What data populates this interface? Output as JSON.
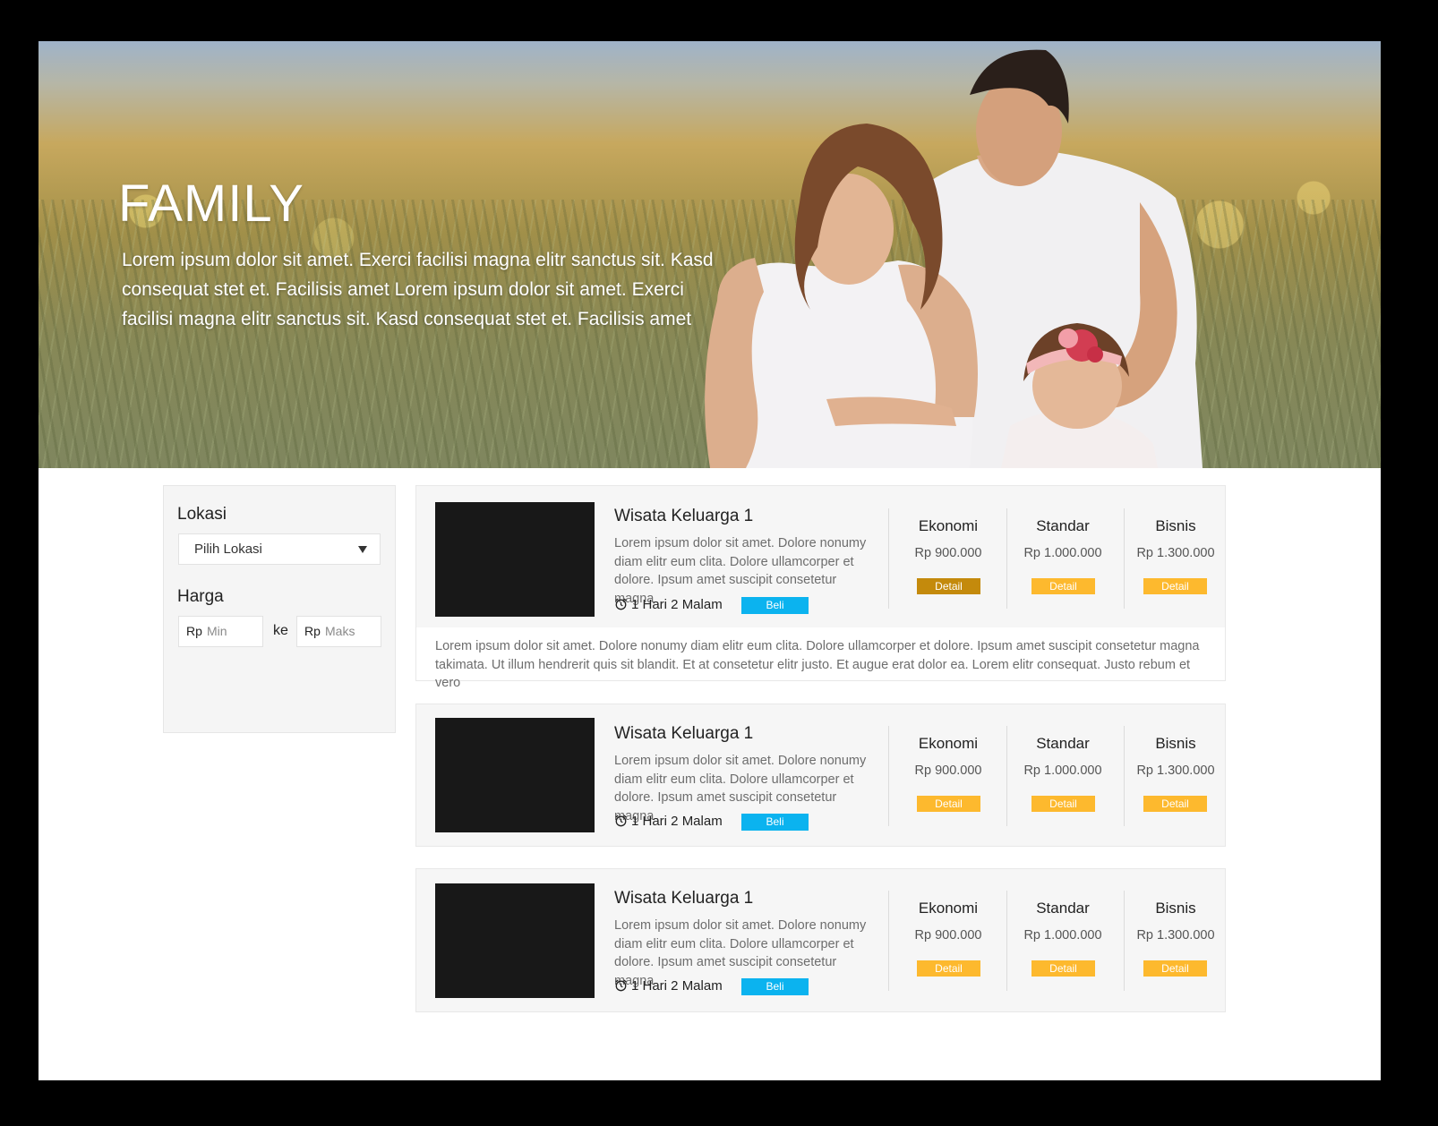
{
  "hero": {
    "title": "FAMILY",
    "description": "Lorem ipsum dolor sit amet. Exerci facilisi magna elitr sanctus sit. Kasd consequat stet et. Facilisis amet Lorem ipsum dolor sit amet. Exerci facilisi magna elitr sanctus sit. Kasd consequat stet et. Facilisis amet"
  },
  "filter": {
    "location_label": "Lokasi",
    "location_select_value": "Pilih Lokasi",
    "price_label": "Harga",
    "currency": "Rp",
    "min_placeholder": "Min",
    "separator": "ke",
    "max_placeholder": "Maks"
  },
  "packages": [
    {
      "title": "Wisata Keluarga 1",
      "description": "Lorem ipsum dolor sit amet. Dolore nonumy diam elitr eum clita. Dolore ullamcorper et dolore. Ipsum amet suscipit consetetur magna",
      "duration": "1 Hari 2 Malam",
      "buy_label": "Beli",
      "tiers": [
        {
          "name": "Ekonomi",
          "price": "Rp 900.000",
          "detail_label": "Detail"
        },
        {
          "name": "Standar",
          "price": "Rp 1.000.000",
          "detail_label": "Detail"
        },
        {
          "name": "Bisnis",
          "price": "Rp 1.300.000",
          "detail_label": "Detail"
        }
      ],
      "expanded_text": "Lorem ipsum dolor sit amet. Dolore nonumy diam elitr eum clita. Dolore ullamcorper et dolore. Ipsum amet suscipit consetetur magna takimata. Ut illum  hendrerit quis sit blandit. Et at consetetur elitr justo. Et augue erat dolor ea. Lorem elitr consequat. Justo rebum et vero"
    },
    {
      "title": "Wisata Keluarga 1",
      "description": "Lorem ipsum dolor sit amet. Dolore nonumy diam elitr eum clita. Dolore ullamcorper et dolore. Ipsum amet suscipit consetetur magna",
      "duration": "1 Hari 2 Malam",
      "buy_label": "Beli",
      "tiers": [
        {
          "name": "Ekonomi",
          "price": "Rp 900.000",
          "detail_label": "Detail"
        },
        {
          "name": "Standar",
          "price": "Rp 1.000.000",
          "detail_label": "Detail"
        },
        {
          "name": "Bisnis",
          "price": "Rp 1.300.000",
          "detail_label": "Detail"
        }
      ]
    },
    {
      "title": "Wisata Keluarga 1",
      "description": "Lorem ipsum dolor sit amet. Dolore nonumy diam elitr eum clita. Dolore ullamcorper et dolore. Ipsum amet suscipit consetetur magna",
      "duration": "1 Hari 2 Malam",
      "buy_label": "Beli",
      "tiers": [
        {
          "name": "Ekonomi",
          "price": "Rp 900.000",
          "detail_label": "Detail"
        },
        {
          "name": "Standar",
          "price": "Rp 1.000.000",
          "detail_label": "Detail"
        },
        {
          "name": "Bisnis",
          "price": "Rp 1.300.000",
          "detail_label": "Detail"
        }
      ]
    }
  ],
  "colors": {
    "buy_button": "#0bb3ef",
    "detail_button": "#fdb92e",
    "detail_button_active": "#c48a0c",
    "thumbnail": "#181818",
    "card_background": "#f6f6f6"
  },
  "icons": {
    "location_dropdown": "chevron-down-icon",
    "duration": "alarm-clock-icon"
  }
}
